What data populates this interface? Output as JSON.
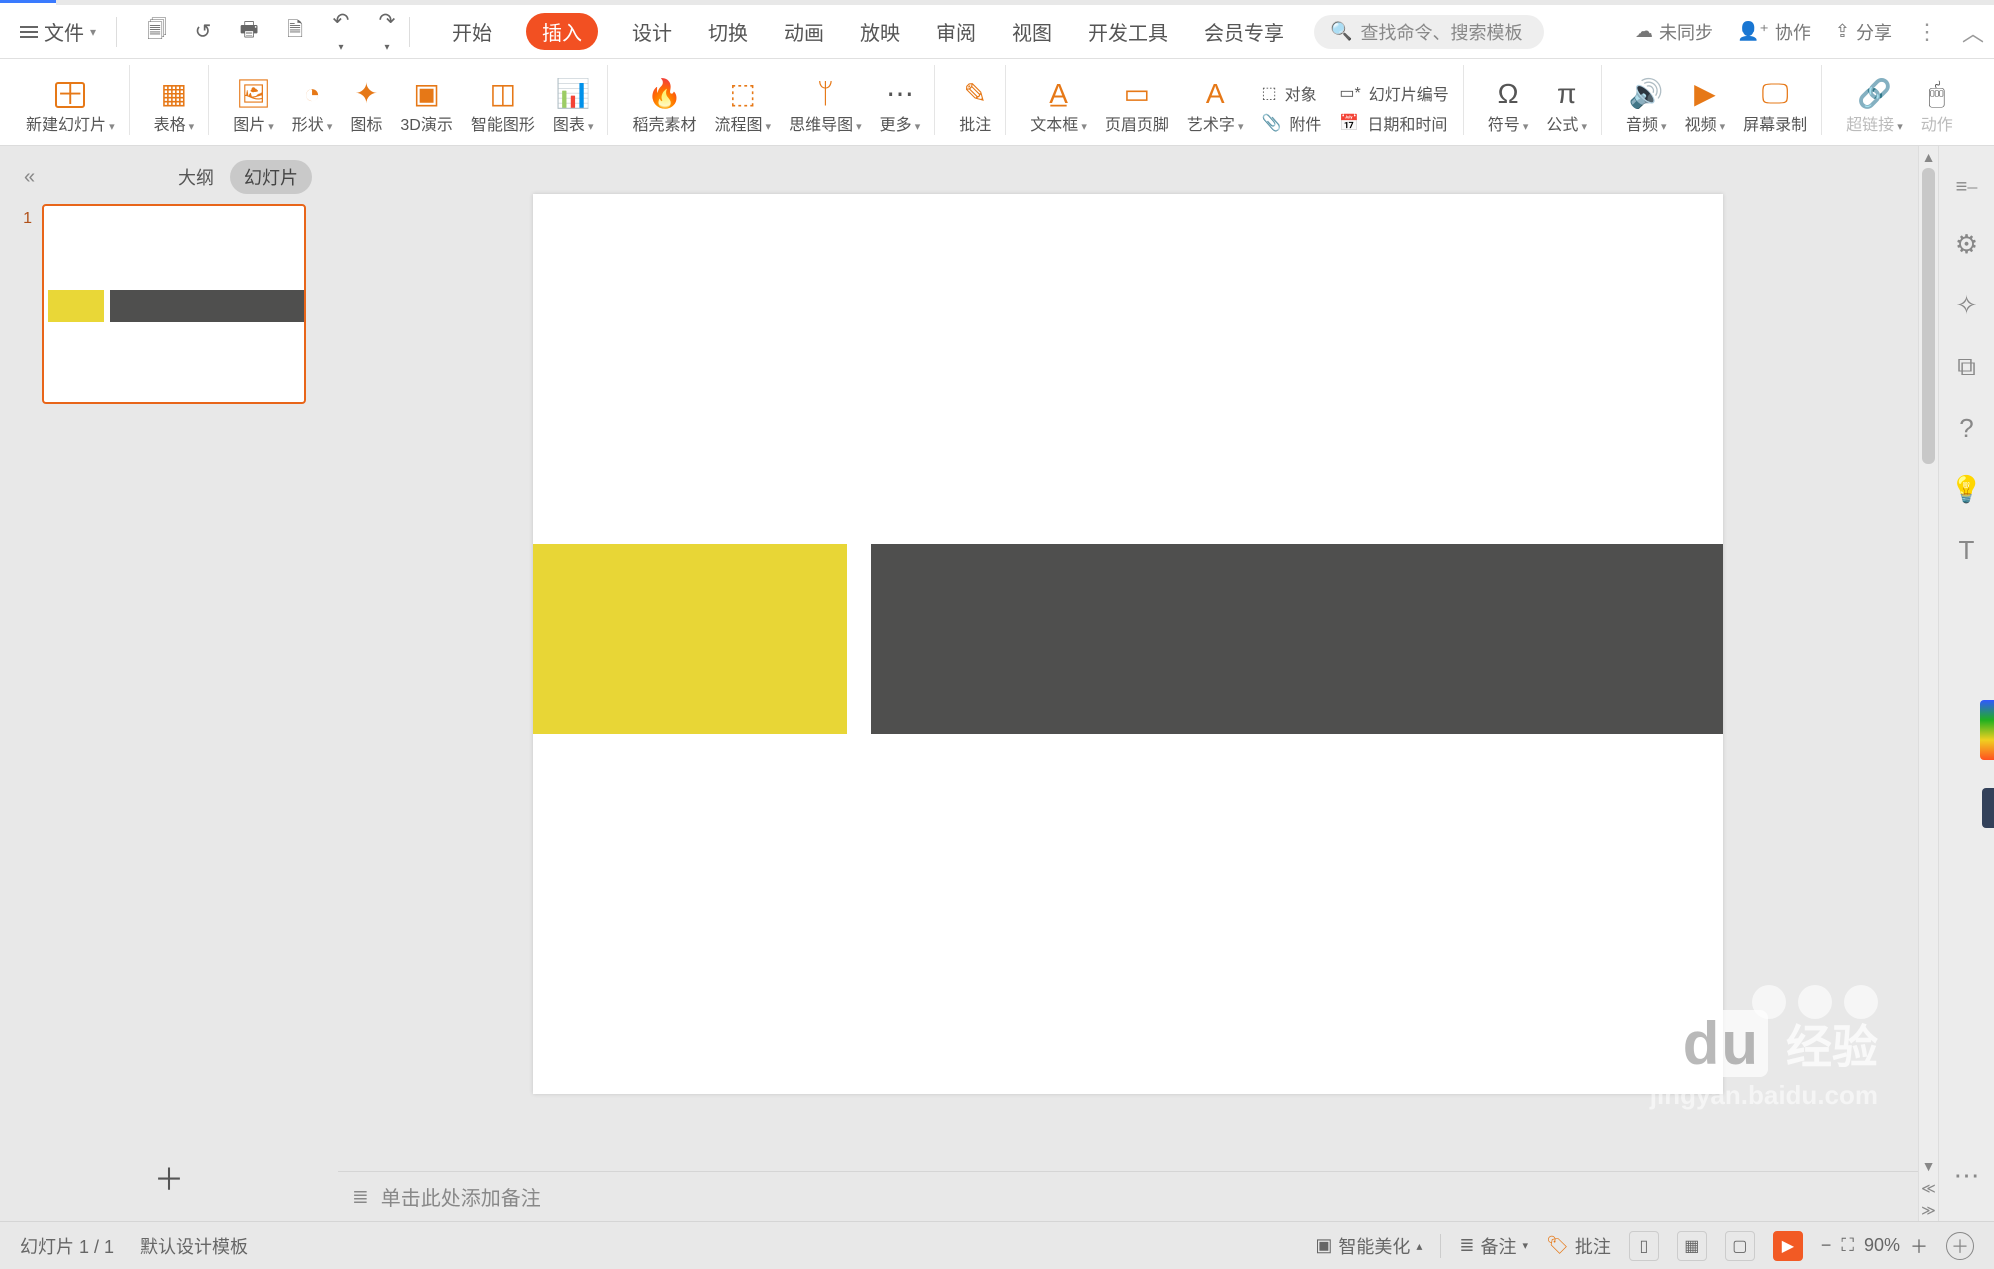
{
  "topbar": {
    "file_label": "文件",
    "qat": {
      "tips": [
        "save",
        "open",
        "print",
        "print-preview",
        "undo",
        "redo"
      ]
    },
    "tabs": [
      "开始",
      "插入",
      "设计",
      "切换",
      "动画",
      "放映",
      "审阅",
      "视图",
      "开发工具",
      "会员专享"
    ],
    "active_tab_index": 1,
    "search_placeholder": "查找命令、搜索模板",
    "right": {
      "unsynced": "未同步",
      "collab": "协作",
      "share": "分享"
    }
  },
  "ribbon": {
    "items": [
      {
        "id": "new-slide",
        "label": "新建幻灯片",
        "dd": true
      },
      {
        "id": "table",
        "label": "表格",
        "dd": true
      },
      {
        "id": "picture",
        "label": "图片",
        "dd": true
      },
      {
        "id": "shape",
        "label": "形状",
        "dd": true
      },
      {
        "id": "icon",
        "label": "图标"
      },
      {
        "id": "3d",
        "label": "3D演示"
      },
      {
        "id": "smart",
        "label": "智能图形"
      },
      {
        "id": "chart",
        "label": "图表",
        "dd": true
      },
      {
        "id": "docer",
        "label": "稻壳素材"
      },
      {
        "id": "flow",
        "label": "流程图",
        "dd": true
      },
      {
        "id": "mind",
        "label": "思维导图",
        "dd": true
      },
      {
        "id": "more",
        "label": "更多",
        "dd": true
      },
      {
        "id": "comment",
        "label": "批注"
      },
      {
        "id": "textbox",
        "label": "文本框",
        "dd": true
      },
      {
        "id": "headerfooter",
        "label": "页眉页脚"
      },
      {
        "id": "wordart",
        "label": "艺术字",
        "dd": true
      },
      {
        "id": "symbol",
        "label": "符号",
        "dd": true
      },
      {
        "id": "formula",
        "label": "公式",
        "dd": true
      },
      {
        "id": "audio",
        "label": "音频",
        "dd": true
      },
      {
        "id": "video",
        "label": "视频",
        "dd": true
      },
      {
        "id": "screenrec",
        "label": "屏幕录制"
      },
      {
        "id": "hyperlink",
        "label": "超链接",
        "dd": true,
        "disabled": true
      },
      {
        "id": "action",
        "label": "动作",
        "disabled": true
      }
    ],
    "compact": {
      "object": "对象",
      "slidenum": "幻灯片编号",
      "attach": "附件",
      "datetime": "日期和时间"
    }
  },
  "left_panel": {
    "collapse_icon": "«",
    "tabs": {
      "outline": "大纲",
      "slides": "幻灯片",
      "active": "slides"
    },
    "slide_number": "1"
  },
  "notes_placeholder": "单击此处添加备注",
  "status": {
    "slide_counter": "幻灯片 1 / 1",
    "template": "默认设计模板",
    "beautify": "智能美化",
    "notes": "备注",
    "comments": "批注",
    "zoom_value": "90%"
  },
  "right_sidebar_icons": [
    "settings-sliders",
    "sparkle",
    "displays",
    "help",
    "lightbulb",
    "text"
  ],
  "watermark": {
    "brand": "Bai",
    "brand_box": "du",
    "jy": "经验",
    "url": "jingyan.baidu.com"
  }
}
